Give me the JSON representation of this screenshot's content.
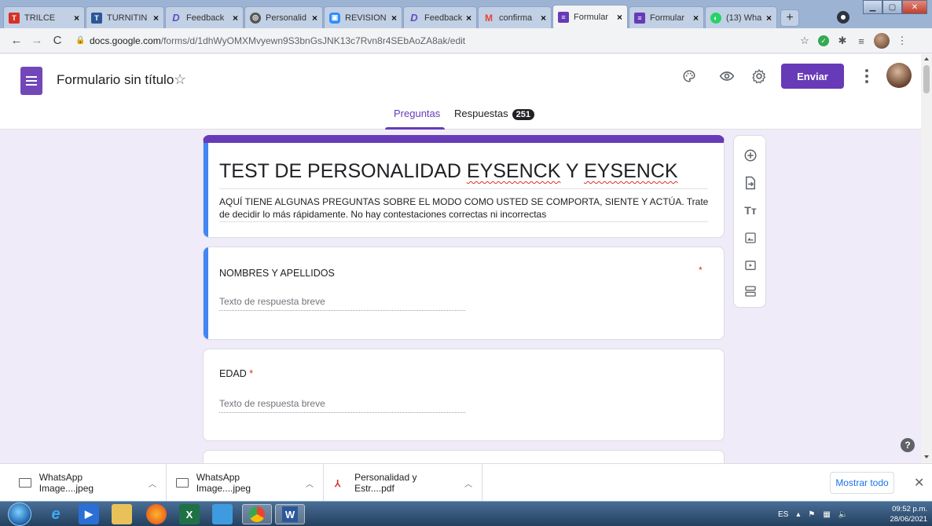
{
  "browser": {
    "tabs": [
      {
        "title": "TRILCE",
        "favicon_color": "#d93025",
        "favicon_glyph": "T",
        "left": 0
      },
      {
        "title": "TURNITIN",
        "favicon_color": "#2b5797",
        "favicon_glyph": "T"
      },
      {
        "title": "Feedback",
        "favicon_color": "#5b4fc4",
        "favicon_glyph": "D"
      },
      {
        "title": "Personalid",
        "favicon_color": "#555",
        "favicon_glyph": "◎"
      },
      {
        "title": "REVISION",
        "favicon_color": "#2d8cff",
        "favicon_glyph": "▣"
      },
      {
        "title": "Feedback",
        "favicon_color": "#5b4fc4",
        "favicon_glyph": "D"
      },
      {
        "title": "confirma",
        "favicon_color": "#ea4335",
        "favicon_glyph": "M"
      },
      {
        "title": "Formular",
        "favicon_color": "#673ab7",
        "favicon_glyph": "≡"
      },
      {
        "title": "Formular",
        "favicon_color": "#673ab7",
        "favicon_glyph": "≡"
      },
      {
        "title": "(13) Wha",
        "favicon_color": "#25d366",
        "favicon_glyph": "◐"
      }
    ],
    "url_host": "docs.google.com",
    "url_path": "/forms/d/1dhWyOMXMvyewn9S3bnGsJNK13c7Rvn8r4SEbAoZA8ak/edit"
  },
  "forms": {
    "doc_title": "Formulario sin título",
    "send_label": "Enviar",
    "tab_questions": "Preguntas",
    "tab_responses": "Respuestas",
    "response_count": "251",
    "accent": "#673ab7"
  },
  "form": {
    "title_part1": "TEST DE PERSONALIDAD ",
    "title_word1": "EYSENCK",
    "title_part2": " Y ",
    "title_word2": "EYSENCK",
    "description": "AQUÍ TIENE ALGUNAS PREGUNTAS SOBRE EL MODO COMO USTED SE COMPORTA, SIENTE Y ACTÚA. Trate de decidir lo más rápidamente. No hay contestaciones correctas ni incorrectas",
    "questions": [
      {
        "title": "NOMBRES Y APELLIDOS",
        "placeholder": "Texto de respuesta breve",
        "required_mark": "*"
      },
      {
        "title": "EDAD",
        "placeholder": "Texto de respuesta breve",
        "required_mark": "*"
      }
    ]
  },
  "downloads": {
    "items": [
      {
        "name": "WhatsApp Image....jpeg"
      },
      {
        "name": "WhatsApp Image....jpeg"
      },
      {
        "name": "Personalidad y Estr....pdf"
      }
    ],
    "show_all": "Mostrar todo"
  },
  "taskbar": {
    "lang": "ES",
    "time": "09:52 p.m.",
    "date": "28/06/2021"
  }
}
